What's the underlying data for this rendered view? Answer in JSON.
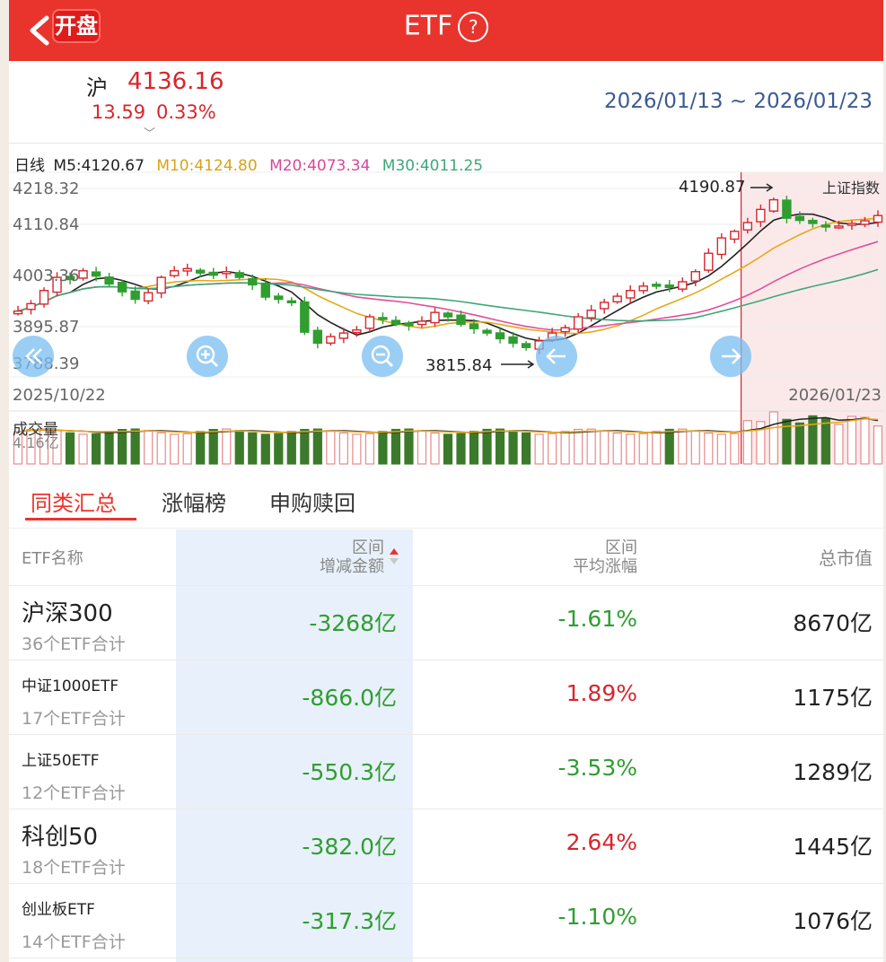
{
  "header": {
    "logo_text": "开盘",
    "title": "ETF"
  },
  "index": {
    "name": "沪",
    "price": "4136.16",
    "change": "13.59",
    "change_pct": "0.33%",
    "date_range": "2026/01/13 ~ 2026/01/23"
  },
  "ma": {
    "prefix": "日线",
    "m5": "M5:4120.67",
    "m10": "M10:4124.80",
    "m20": "M20:4073.34",
    "m30": "M30:4011.25"
  },
  "colors": {
    "brand": "#e8342d",
    "up": "#d7262d",
    "down": "#2f9e2f",
    "m5": "#222222",
    "m10": "#e6a817",
    "m20": "#e0509a",
    "m30": "#3fa77a",
    "highlight_column": "#e8f1fb"
  },
  "chart_data": {
    "type": "candlestick",
    "price_axis_labels": [
      "4218.32",
      "4110.84",
      "4003.36",
      "3895.87",
      "3788.39"
    ],
    "ylim": [
      3788.39,
      4218.32
    ],
    "start_date": "2025/10/22",
    "end_date": "2026/01/23",
    "high_marker": "4190.87",
    "low_marker": "3815.84",
    "index_label": "上证指数",
    "volume_label": "成交量",
    "volume_value": "4.16亿",
    "closes": [
      3918,
      3935,
      3965,
      3995,
      3990,
      4010,
      3998,
      3980,
      3962,
      3945,
      3960,
      3995,
      4010,
      4015,
      4005,
      4000,
      4008,
      3995,
      3978,
      3950,
      3945,
      3940,
      3870,
      3845,
      3860,
      3868,
      3875,
      3905,
      3900,
      3888,
      3885,
      3895,
      3915,
      3905,
      3888,
      3878,
      3868,
      3855,
      3845,
      3835,
      3850,
      3868,
      3880,
      3905,
      3920,
      3938,
      3952,
      3965,
      3975,
      3978,
      3972,
      3985,
      4008,
      4050,
      4085,
      4100,
      4120,
      4150,
      4172,
      4130,
      4125,
      4118,
      4110,
      4112,
      4118,
      4124,
      4136
    ]
  },
  "tabs": [
    "同类汇总",
    "涨幅榜",
    "申购赎回"
  ],
  "table": {
    "col_name": "ETF名称",
    "col_amount": [
      "区间",
      "增减金额"
    ],
    "col_change": [
      "区间",
      "平均涨幅"
    ],
    "col_cap": "总市值",
    "rows": [
      {
        "name": "沪深300",
        "sub": "36个ETF合计",
        "amount": "-3268亿",
        "change": "-1.61%",
        "cap": "8670亿"
      },
      {
        "name": "中证1000ETF",
        "sub": "17个ETF合计",
        "amount": "-866.0亿",
        "change": "1.89%",
        "cap": "1175亿"
      },
      {
        "name": "上证50ETF",
        "sub": "12个ETF合计",
        "amount": "-550.3亿",
        "change": "-3.53%",
        "cap": "1289亿"
      },
      {
        "name": "科创50",
        "sub": "18个ETF合计",
        "amount": "-382.0亿",
        "change": "2.64%",
        "cap": "1445亿"
      },
      {
        "name": "创业板ETF",
        "sub": "14个ETF合计",
        "amount": "-317.3亿",
        "change": "-1.10%",
        "cap": "1076亿"
      }
    ]
  }
}
